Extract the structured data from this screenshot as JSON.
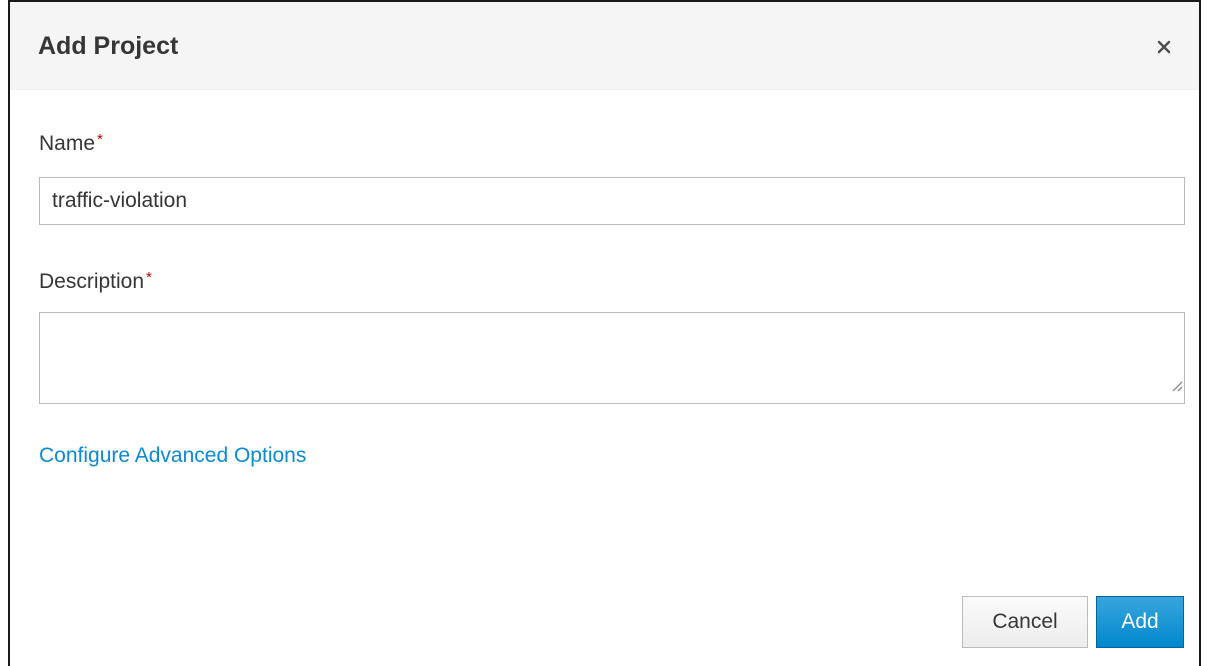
{
  "dialog": {
    "title": "Add Project",
    "close_icon": "close-icon",
    "close_glyph": "×"
  },
  "form": {
    "name": {
      "label": "Name",
      "required_marker": "*",
      "value": "traffic-violation"
    },
    "description": {
      "label": "Description",
      "required_marker": "*",
      "value": ""
    },
    "advanced_link": "Configure Advanced Options"
  },
  "footer": {
    "cancel_label": "Cancel",
    "add_label": "Add"
  },
  "colors": {
    "primary": "#0088ce",
    "link": "#0a8ad3",
    "required": "#c00000",
    "header_bg": "#f5f5f5"
  }
}
